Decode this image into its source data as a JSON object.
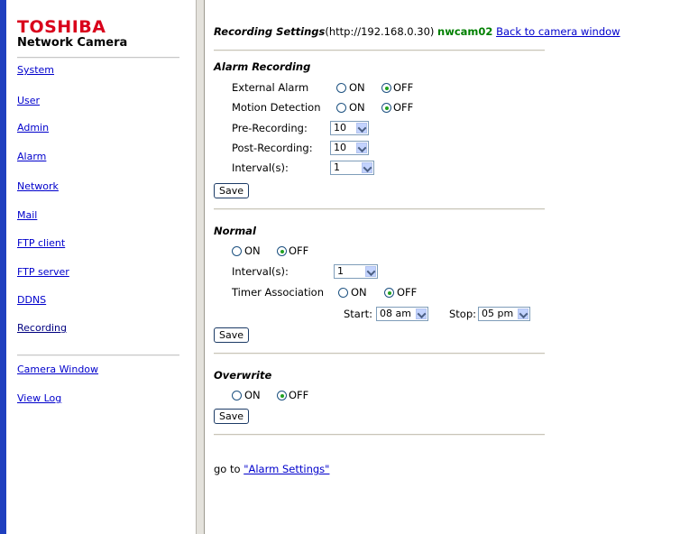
{
  "brand": {
    "name": "TOSHIBA",
    "subtitle": "Network Camera"
  },
  "sidebar": {
    "items": [
      {
        "label": "System"
      },
      {
        "label": "User"
      },
      {
        "label": "Admin"
      },
      {
        "label": "Alarm"
      },
      {
        "label": "Network"
      },
      {
        "label": "Mail"
      },
      {
        "label": "FTP client"
      },
      {
        "label": "FTP server"
      },
      {
        "label": "DDNS"
      },
      {
        "label": "Recording"
      }
    ],
    "footer_items": [
      {
        "label": "Camera Window"
      },
      {
        "label": "View Log"
      }
    ]
  },
  "header": {
    "title": "Recording Settings",
    "address": "(http://192.168.0.30)",
    "camera_name": "nwcam02",
    "back_link": "Back to camera window"
  },
  "alarm_recording": {
    "heading": "Alarm Recording",
    "external_alarm": {
      "label": "External Alarm",
      "on": "ON",
      "off": "OFF",
      "selected": "OFF"
    },
    "motion_detection": {
      "label": "Motion Detection",
      "on": "ON",
      "off": "OFF",
      "selected": "OFF"
    },
    "pre_recording": {
      "label": "Pre-Recording:",
      "value": "10"
    },
    "post_recording": {
      "label": "Post-Recording:",
      "value": "10"
    },
    "interval": {
      "label": "Interval(s):",
      "value": "1"
    },
    "save": "Save"
  },
  "normal": {
    "heading": "Normal",
    "on": "ON",
    "off": "OFF",
    "selected": "OFF",
    "interval": {
      "label": "Interval(s):",
      "value": "1"
    },
    "timer_association": {
      "label": "Timer Association",
      "on": "ON",
      "off": "OFF",
      "selected": "OFF"
    },
    "start": {
      "label": "Start:",
      "value": "08 am"
    },
    "stop": {
      "label": "Stop:",
      "value": "05 pm"
    },
    "save": "Save"
  },
  "overwrite": {
    "heading": "Overwrite",
    "on": "ON",
    "off": "OFF",
    "selected": "OFF",
    "save": "Save"
  },
  "goto": {
    "prefix": "go to ",
    "link": "\"Alarm Settings\""
  }
}
